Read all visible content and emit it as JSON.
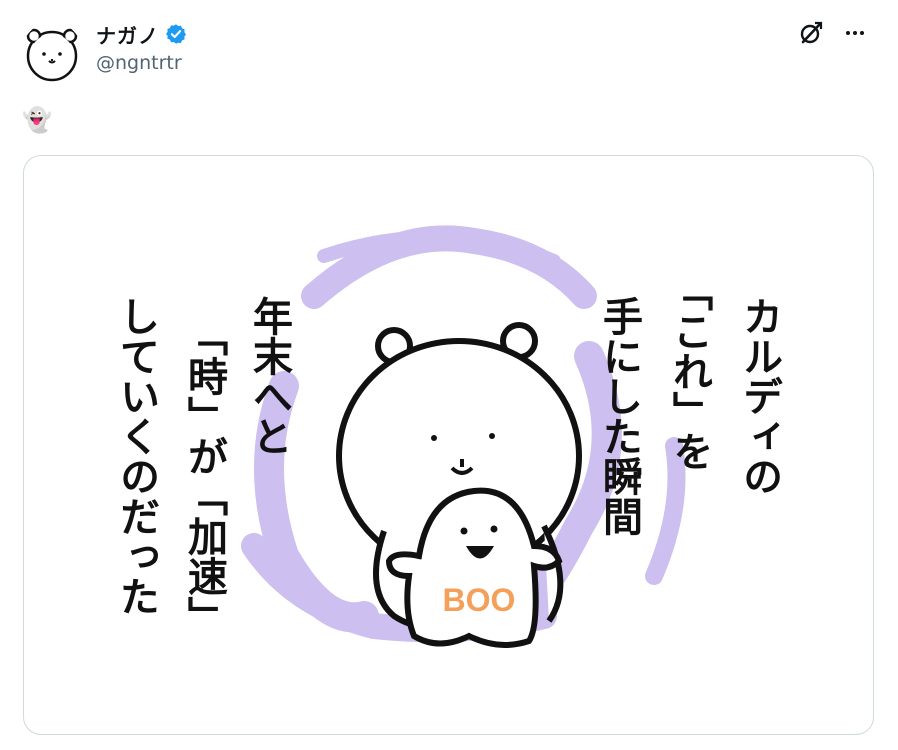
{
  "author": {
    "display_name": "ナガノ",
    "handle": "@ngntrtr",
    "verified": true,
    "avatar_icon": "bear-avatar-icon"
  },
  "header_actions": [
    {
      "name": "grok-icon"
    },
    {
      "name": "more-icon",
      "label": "···"
    }
  ],
  "tweet": {
    "text": "👻"
  },
  "media": {
    "columns": [
      "カルディの",
      "「これ」を",
      "手にした瞬間",
      "年末へと",
      "「時」が「加速」",
      "していくのだった"
    ],
    "ghost_label": "BOO"
  },
  "colors": {
    "verified_blue": "#1d9bf0",
    "handle_gray": "#536471",
    "aura_purple": "#cdbff0",
    "boo_orange": "#f5a05a"
  }
}
